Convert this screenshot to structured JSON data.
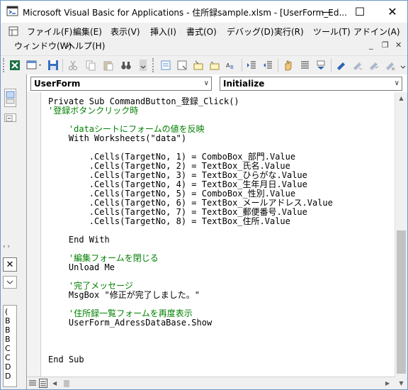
{
  "window": {
    "title": "Microsoft Visual Basic for Applications - 住所録sample.xlsm - [UserForm_Ed...",
    "minimize_glyph": "—",
    "maximize_glyph": "☐",
    "close_glyph": "✕"
  },
  "menu": {
    "items": [
      "ファイル(F)",
      "編集(E)",
      "表示(V)",
      "挿入(I)",
      "書式(O)",
      "デバッグ(D)",
      "実行(R)",
      "ツール(T)",
      "アドイン(A)"
    ],
    "row2": [
      "ウィンドウ(W)",
      "ヘルプ(H)"
    ],
    "mdi_min": "_",
    "mdi_restore": "❐",
    "mdi_close": "✕"
  },
  "editor": {
    "object_combo": "UserForm",
    "procedure_combo": "Initialize",
    "code_lines": [
      {
        "text": "Private Sub CommandButton_登録_Click()",
        "type": "code"
      },
      {
        "text": "'登録ボタンクリック時",
        "type": "comment"
      },
      {
        "text": "",
        "type": "code"
      },
      {
        "text": "    'dataシートにフォームの値を反映",
        "type": "comment"
      },
      {
        "text": "    With Worksheets(\"data\")",
        "type": "code"
      },
      {
        "text": "",
        "type": "code"
      },
      {
        "text": "        .Cells(TargetNo, 1) = ComboBox_部門.Value",
        "type": "code"
      },
      {
        "text": "        .Cells(TargetNo, 2) = TextBox_氏名.Value",
        "type": "code"
      },
      {
        "text": "        .Cells(TargetNo, 3) = TextBox_ひらがな.Value",
        "type": "code"
      },
      {
        "text": "        .Cells(TargetNo, 4) = TextBox_生年月日.Value",
        "type": "code"
      },
      {
        "text": "        .Cells(TargetNo, 5) = ComboBox_性別.Value",
        "type": "code"
      },
      {
        "text": "        .Cells(TargetNo, 6) = TextBox_メールアドレス.Value",
        "type": "code"
      },
      {
        "text": "        .Cells(TargetNo, 7) = TextBox_郵便番号.Value",
        "type": "code"
      },
      {
        "text": "        .Cells(TargetNo, 8) = TextBox_住所.Value",
        "type": "code"
      },
      {
        "text": "",
        "type": "code"
      },
      {
        "text": "    End With",
        "type": "code"
      },
      {
        "text": "",
        "type": "code"
      },
      {
        "text": "    '編集フォームを閉じる",
        "type": "comment"
      },
      {
        "text": "    Unload Me",
        "type": "code"
      },
      {
        "text": "",
        "type": "code"
      },
      {
        "text": "    '完了メッセージ",
        "type": "comment"
      },
      {
        "text": "    MsgBox \"修正が完了しました。\"",
        "type": "code"
      },
      {
        "text": "",
        "type": "code"
      },
      {
        "text": "    '住所録一覧フォームを再度表示",
        "type": "comment"
      },
      {
        "text": "    UserForm_AdressDataBase.Show",
        "type": "code"
      },
      {
        "text": "",
        "type": "code"
      },
      {
        "text": "",
        "type": "code"
      },
      {
        "text": "",
        "type": "code"
      },
      {
        "text": "End Sub",
        "type": "code"
      }
    ]
  },
  "leftpanel": {
    "close_glyph": "✕",
    "letters": [
      "(",
      "B",
      "B",
      "B",
      "C",
      "C",
      "D",
      "D"
    ]
  },
  "colors": {
    "comment": "#008000",
    "title_bar": "#ffffff",
    "chrome": "#f0f0f0"
  }
}
